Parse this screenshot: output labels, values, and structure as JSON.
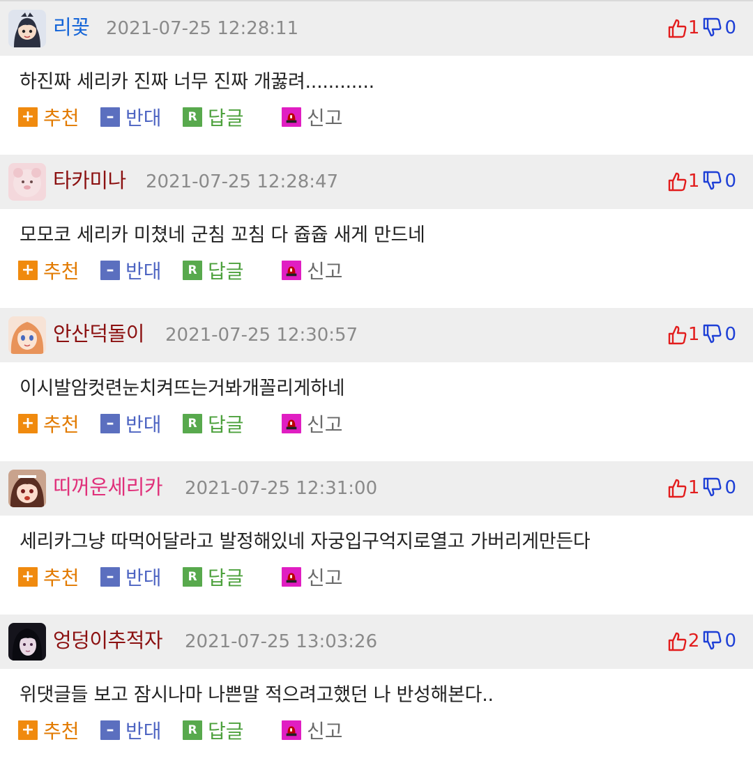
{
  "actions": {
    "recommend": "추천",
    "oppose": "반대",
    "reply": "답글",
    "report": "신고",
    "reply_badge": "R"
  },
  "colors": {
    "header_bg": "#eeeeee",
    "upvote": "#e21d1d",
    "downvote": "#1d3fd6",
    "recommend": "#f08a0e",
    "oppose": "#5b6fbf",
    "reply": "#58a94d",
    "report": "#e01ec2"
  },
  "comments": [
    {
      "author": "리꽃",
      "author_color": "#1565d8",
      "date": "2021-07-25 12:28:11",
      "text": "하진짜 세리카 진짜 너무 진짜 개꿇려............",
      "up": "1",
      "down": "0",
      "avatar": "anime-girl-dark-hair"
    },
    {
      "author": "타카미나",
      "author_color": "#8b1010",
      "date": "2021-07-25 12:28:47",
      "text": "모모코 세리카 미쳤네 군침 꼬침 다 쥽쥽 새게 만드네",
      "up": "1",
      "down": "0",
      "avatar": "pink-plush"
    },
    {
      "author": "안산덕돌이",
      "author_color": "#8b1010",
      "date": "2021-07-25 12:30:57",
      "text": "이시발암컷련눈치켜뜨는거봐개꼴리게하네",
      "up": "1",
      "down": "0",
      "avatar": "anime-girl-orange-hair"
    },
    {
      "author": "띠꺼운세리카",
      "author_color": "#e0307a",
      "date": "2021-07-25 12:31:00",
      "text": "세리카그냥 따먹어달라고 발정해있네 자궁입구억지로열고 가버리게만든다",
      "up": "1",
      "down": "0",
      "avatar": "anime-girl-crying"
    },
    {
      "author": "엉덩이추적자",
      "author_color": "#8b1010",
      "date": "2021-07-25 13:03:26",
      "text": "위댓글들 보고 잠시나마 나쁜말 적으려고했던 나 반성해본다..",
      "up": "2",
      "down": "0",
      "avatar": "dark-haired-girl"
    }
  ]
}
